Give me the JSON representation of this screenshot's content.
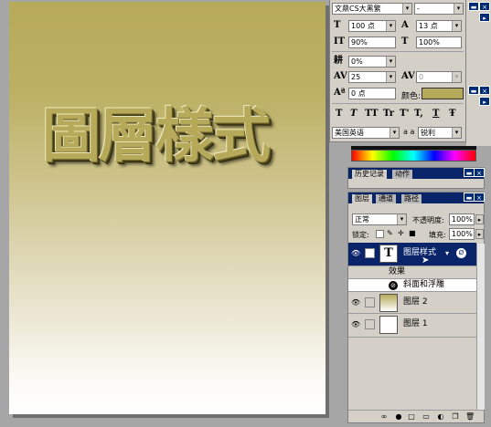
{
  "canvas": {
    "art_text": "圖層樣式"
  },
  "character": {
    "font_family": "文鼎CS大黑繁",
    "font_style": "-",
    "font_size": "100 点",
    "leading": "13 点",
    "vertical_scale": "90%",
    "horizontal_scale": "100%",
    "tracking_adjust": "0%",
    "tracking": "25",
    "kerning": "0",
    "baseline_shift": "0 点",
    "color_label": "颜色:",
    "color_value": "#b6aa5a",
    "format_buttons": [
      "T",
      "T",
      "TT",
      "Tr",
      "T'",
      "T,",
      "T",
      "Ŧ"
    ],
    "language": "美国英语",
    "aa_label": "a a",
    "antialias": "锐利"
  },
  "history": {
    "tabs": [
      "历史记录",
      "动作"
    ]
  },
  "layers": {
    "tabs": [
      "图层",
      "通道",
      "路径"
    ],
    "blend_mode": "正常",
    "opacity_label": "不透明度:",
    "opacity_value": "100%",
    "lock_label": "锁定:",
    "fill_label": "填充:",
    "fill_value": "100%",
    "items": [
      {
        "name": "图层样式",
        "thumb": "T"
      },
      {
        "name": "效果"
      },
      {
        "name": "斜面和浮雕"
      },
      {
        "name": "图层 2"
      },
      {
        "name": "图层 1"
      }
    ],
    "fx_label": "Ø"
  }
}
